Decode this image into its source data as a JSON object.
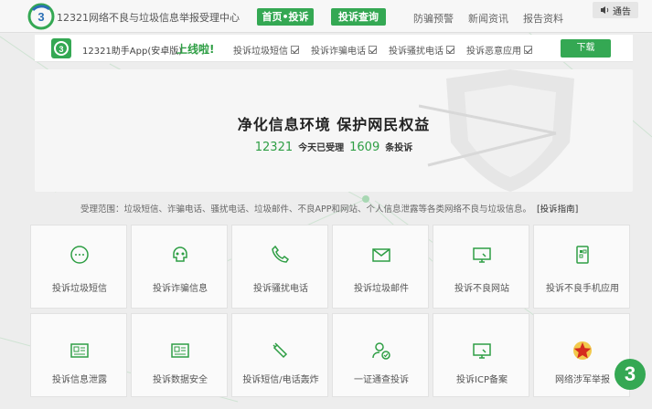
{
  "header": {
    "site_title": "12321网络不良与垃圾信息举报受理中心",
    "nav_home": "首页•投诉",
    "nav_query": "投诉查询",
    "nav_fraud": "防骗预警",
    "nav_news": "新闻资讯",
    "nav_report": "报告资料",
    "notice": "通告"
  },
  "appbar": {
    "app_text": "12321助手App(安卓版)",
    "online": "上线啦!",
    "links": [
      "投诉垃圾短信",
      "投诉诈骗电话",
      "投诉骚扰电话",
      "投诉恶意应用"
    ],
    "download": "下载"
  },
  "hero": {
    "title": "净化信息环境  保护网民权益",
    "count1": "12321",
    "text1": "今天已受理",
    "count2": "1609",
    "text2": "条投诉"
  },
  "scope": {
    "text": "受理范围：垃圾短信、诈骗电话、骚扰电话、垃圾邮件、不良APP和网站、个人信息泄露等各类网络不良与垃圾信息。",
    "guide": "[投诉指南]"
  },
  "tiles": [
    {
      "label": "投诉垃圾短信",
      "icon": "chat-bubble-icon"
    },
    {
      "label": "投诉诈骗信息",
      "icon": "skull-icon"
    },
    {
      "label": "投诉骚扰电话",
      "icon": "phone-icon"
    },
    {
      "label": "投诉垃圾邮件",
      "icon": "mail-icon"
    },
    {
      "label": "投诉不良网站",
      "icon": "monitor-icon"
    },
    {
      "label": "投诉不良手机应用",
      "icon": "phone-app-icon"
    },
    {
      "label": "投诉信息泄露",
      "icon": "id-card-icon"
    },
    {
      "label": "投诉数据安全",
      "icon": "id-card-icon"
    },
    {
      "label": "投诉短信/电话轰炸",
      "icon": "bomb-icon"
    },
    {
      "label": "一证通查投诉",
      "icon": "user-check-icon"
    },
    {
      "label": "投诉ICP备案",
      "icon": "monitor-icon"
    },
    {
      "label": "网络涉军举报",
      "icon": "star-emblem-icon"
    }
  ],
  "badge": "3",
  "colors": {
    "brand": "#34a853",
    "brand_dark": "#2e9e44",
    "background": "#ededed",
    "accent_red": "#d52b1e"
  }
}
